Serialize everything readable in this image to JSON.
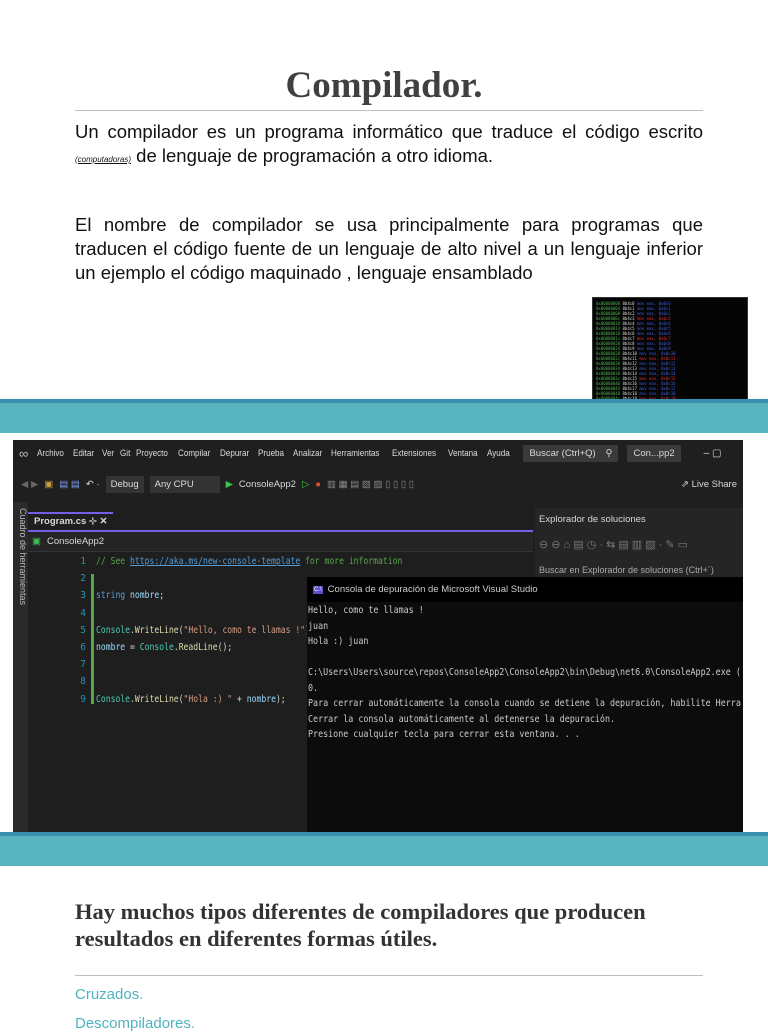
{
  "title": "Compilador.",
  "para1": {
    "before": "Un compilador es un programa informático que traduce el código escrito ",
    "small": "(computadoras)",
    "after": " de lenguaje de programación a otro idioma."
  },
  "para2": "El nombre de compilador se usa principalmente para programas que traducen el código fuente de un lenguaje de alto nivel a un lenguaje inferior un ejemplo el código maquinado , lenguaje ensamblado",
  "colors": {
    "band": "#58b4be",
    "accent": "#4fb3bf",
    "vs_bg": "#1f1f1f",
    "purple": "#7160e8"
  },
  "vs": {
    "menu": [
      "Archivo",
      "Editar",
      "Ver",
      "Git",
      "Proyecto",
      "Compilar",
      "Depurar",
      "Prueba",
      "Analizar",
      "Herramientas",
      "Extensiones",
      "Ventana",
      "Ayuda"
    ],
    "search": "Buscar (Ctrl+Q)",
    "solution": "Con...pp2",
    "toolbar": {
      "config": "Debug",
      "platform": "Any CPU",
      "run": "ConsoleApp2",
      "liveshare": "Live Share"
    },
    "toolbox": "Cuadro de herramientas",
    "tab": "Program.cs",
    "nav_project": "ConsoleApp2",
    "code": [
      {
        "n": "1",
        "parts": [
          {
            "c": "cm",
            "t": "// See "
          },
          {
            "c": "lk",
            "t": "https://aka.ms/new-console-template"
          },
          {
            "c": "cm",
            "t": " for more information"
          }
        ]
      },
      {
        "n": "2",
        "parts": []
      },
      {
        "n": "3",
        "parts": [
          {
            "c": "kw",
            "t": "string "
          },
          {
            "c": "vr",
            "t": "nombre"
          },
          {
            "c": "",
            "t": ";"
          }
        ]
      },
      {
        "n": "4",
        "parts": []
      },
      {
        "n": "5",
        "parts": [
          {
            "c": "ty",
            "t": "Console"
          },
          {
            "c": "",
            "t": "."
          },
          {
            "c": "yl",
            "t": "WriteLine"
          },
          {
            "c": "",
            "t": "("
          },
          {
            "c": "st",
            "t": "\"Hello, como te llamas !\""
          },
          {
            "c": "",
            "t": ");"
          }
        ]
      },
      {
        "n": "6",
        "parts": [
          {
            "c": "vr",
            "t": "nombre"
          },
          {
            "c": "",
            "t": " = "
          },
          {
            "c": "ty",
            "t": "Console"
          },
          {
            "c": "",
            "t": "."
          },
          {
            "c": "yl",
            "t": "ReadLine"
          },
          {
            "c": "",
            "t": "();"
          }
        ]
      },
      {
        "n": "7",
        "parts": []
      },
      {
        "n": "8",
        "parts": []
      },
      {
        "n": "9",
        "parts": [
          {
            "c": "ty",
            "t": "Console"
          },
          {
            "c": "",
            "t": "."
          },
          {
            "c": "yl",
            "t": "WriteLine"
          },
          {
            "c": "",
            "t": "("
          },
          {
            "c": "st",
            "t": "\"Hola :) \""
          },
          {
            "c": "",
            "t": " + "
          },
          {
            "c": "vr",
            "t": "nombre"
          },
          {
            "c": "",
            "t": ");"
          }
        ]
      }
    ],
    "solution_explorer": {
      "title": "Explorador de soluciones",
      "search": "Buscar en Explorador de soluciones (Ctrl+´)"
    },
    "console": {
      "title": "Consola de depuración de Microsoft Visual Studio",
      "lines": [
        "Hello, como te llamas !",
        "juan",
        "Hola :) juan",
        "",
        "C:\\Users\\Users\\source\\repos\\ConsoleApp2\\ConsoleApp2\\bin\\Debug\\net6.0\\ConsoleApp2.exe (",
        "0.",
        "Para cerrar automáticamente la consola cuando se detiene la depuración, habilite Herra",
        "Cerrar la consola automáticamente al detenerse la depuración.",
        "Presione cualquier tecla para cerrar esta ventana. . ."
      ]
    }
  },
  "heading2": "Hay muchos tipos diferentes de compiladores que producen resultados en diferentes formas útiles.",
  "list": [
    "Cruzados.",
    "Descompiladores."
  ]
}
